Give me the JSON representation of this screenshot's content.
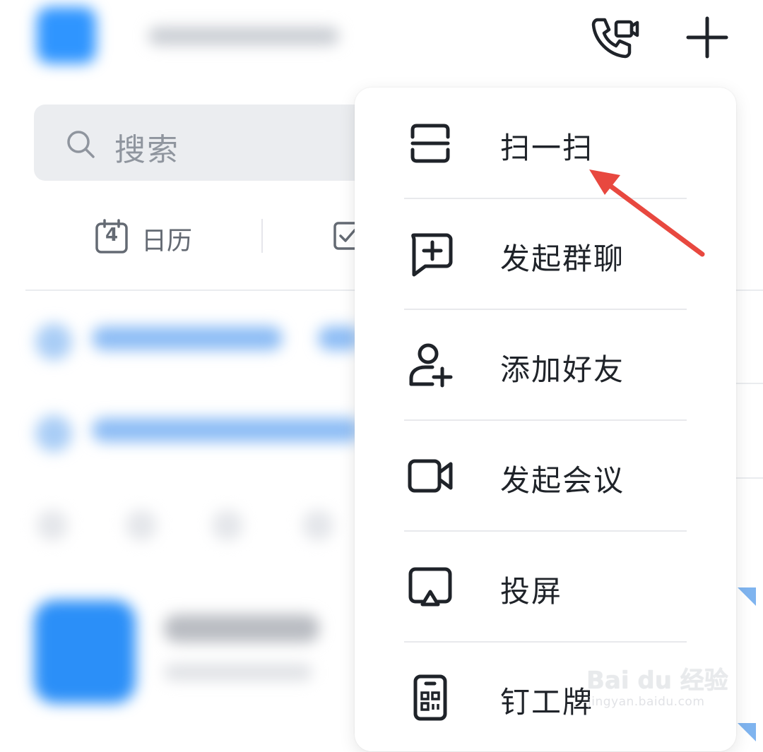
{
  "search": {
    "placeholder": "搜索"
  },
  "tabs": {
    "calendar_day": "4",
    "calendar_label": "日历"
  },
  "menu": {
    "items": [
      {
        "label": "扫一扫",
        "icon": "scan-icon"
      },
      {
        "label": "发起群聊",
        "icon": "new-group-chat-icon"
      },
      {
        "label": "添加好友",
        "icon": "add-friend-icon"
      },
      {
        "label": "发起会议",
        "icon": "video-meeting-icon"
      },
      {
        "label": "投屏",
        "icon": "screen-cast-icon"
      },
      {
        "label": "钉工牌",
        "icon": "work-badge-icon"
      }
    ]
  },
  "header_icons": [
    "call-video-icon",
    "plus-icon"
  ],
  "annotation": {
    "color": "#e8483f",
    "points_to": "扫一扫"
  },
  "watermark": {
    "main": "Bai du 经验",
    "sub": "jingyan.baidu.com"
  },
  "colors": {
    "accent_blue": "#2f95ff",
    "menu_bg": "#ffffff",
    "search_bg": "#ebedf0"
  }
}
